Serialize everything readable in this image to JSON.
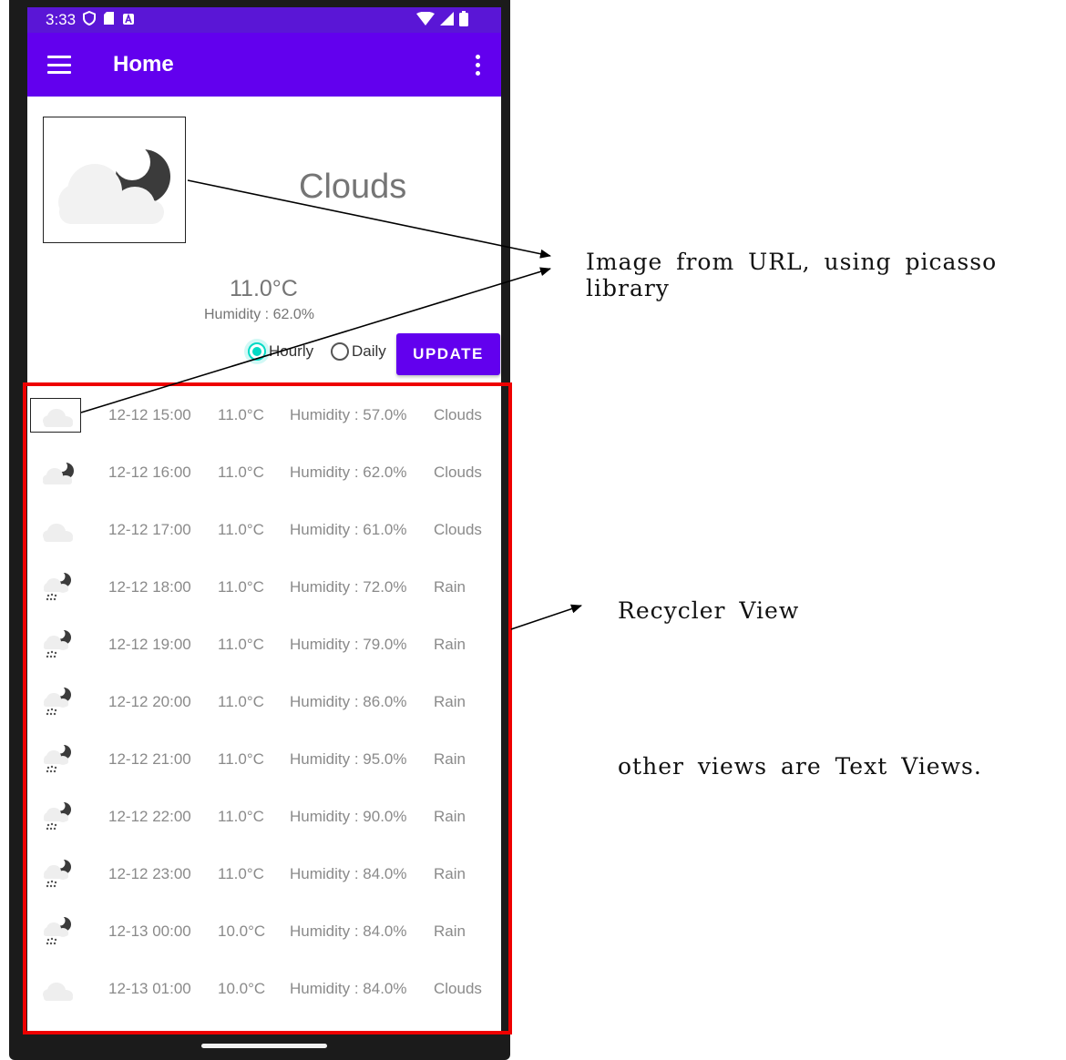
{
  "status_bar": {
    "time": "3:33"
  },
  "app_bar": {
    "title": "Home"
  },
  "current": {
    "weather": "Clouds",
    "temperature": "11.0°C",
    "humidity": "Humidity : 62.0%"
  },
  "controls": {
    "radio_hourly": "Hourly",
    "radio_daily": "Daily",
    "selected": "Hourly",
    "update_label": "UPDATE"
  },
  "forecast": [
    {
      "time": "12-12 15:00",
      "temp": "11.0°C",
      "humidity": "Humidity : 57.0%",
      "main": "Clouds",
      "icon": "cloud-light-icon"
    },
    {
      "time": "12-12 16:00",
      "temp": "11.0°C",
      "humidity": "Humidity : 62.0%",
      "main": "Clouds",
      "icon": "cloud-moon-icon"
    },
    {
      "time": "12-12 17:00",
      "temp": "11.0°C",
      "humidity": "Humidity : 61.0%",
      "main": "Clouds",
      "icon": "cloud-light-icon"
    },
    {
      "time": "12-12 18:00",
      "temp": "11.0°C",
      "humidity": "Humidity : 72.0%",
      "main": "Rain",
      "icon": "rain-moon-icon"
    },
    {
      "time": "12-12 19:00",
      "temp": "11.0°C",
      "humidity": "Humidity : 79.0%",
      "main": "Rain",
      "icon": "rain-moon-icon"
    },
    {
      "time": "12-12 20:00",
      "temp": "11.0°C",
      "humidity": "Humidity : 86.0%",
      "main": "Rain",
      "icon": "rain-moon-icon"
    },
    {
      "time": "12-12 21:00",
      "temp": "11.0°C",
      "humidity": "Humidity : 95.0%",
      "main": "Rain",
      "icon": "rain-moon-icon"
    },
    {
      "time": "12-12 22:00",
      "temp": "11.0°C",
      "humidity": "Humidity : 90.0%",
      "main": "Rain",
      "icon": "rain-moon-icon"
    },
    {
      "time": "12-12 23:00",
      "temp": "11.0°C",
      "humidity": "Humidity : 84.0%",
      "main": "Rain",
      "icon": "rain-moon-icon"
    },
    {
      "time": "12-13 00:00",
      "temp": "10.0°C",
      "humidity": "Humidity : 84.0%",
      "main": "Rain",
      "icon": "rain-moon-icon"
    },
    {
      "time": "12-13 01:00",
      "temp": "10.0°C",
      "humidity": "Humidity : 84.0%",
      "main": "Clouds",
      "icon": "cloud-light-icon"
    }
  ],
  "annotations": {
    "image_note": "Image from URL, using picasso library",
    "recycler_note": "Recycler View",
    "views_note": "other views are Text Views."
  },
  "colors": {
    "app_bar": "#6200ee",
    "status_bar": "#5a16d6",
    "accent": "#03dac5",
    "highlight_border": "#ee0000"
  }
}
